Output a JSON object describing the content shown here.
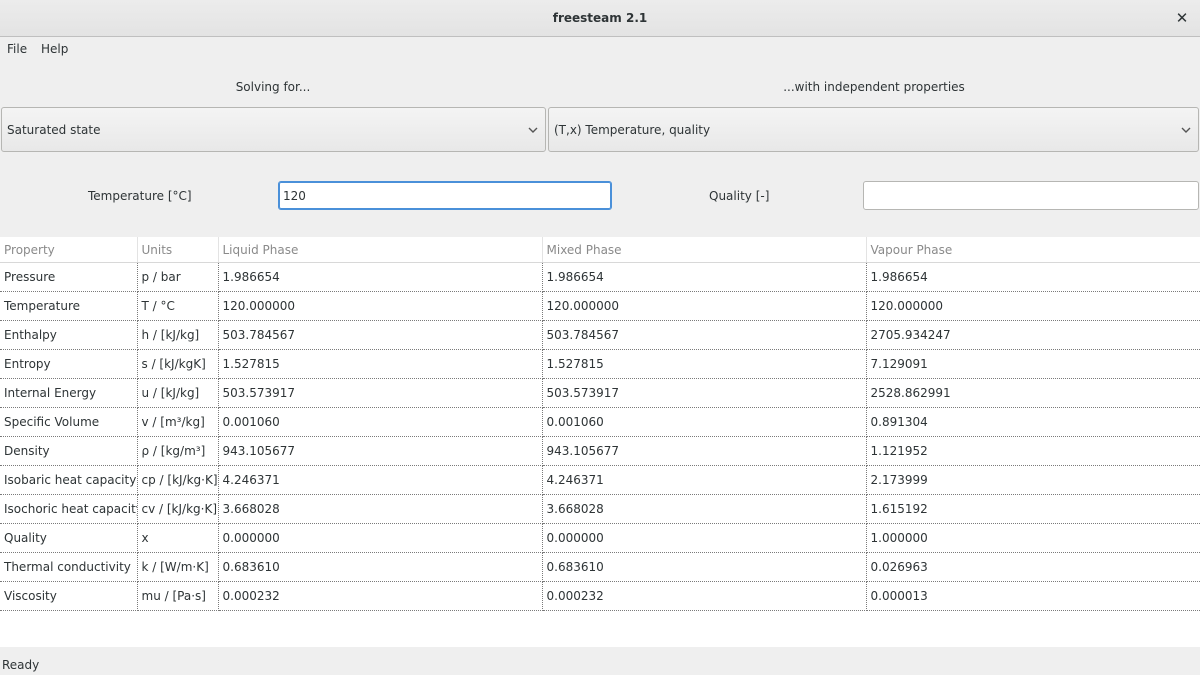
{
  "window": {
    "title": "freesteam 2.1"
  },
  "menu": {
    "file": "File",
    "help": "Help"
  },
  "solving_for": {
    "label": "Solving for...",
    "selected": "Saturated state"
  },
  "independent": {
    "label": "...with independent properties",
    "selected": "(T,x)  Temperature, quality"
  },
  "inputs": {
    "temperature_label": "Temperature [°C]",
    "temperature_value": "120",
    "quality_label": "Quality [-]",
    "quality_value": ""
  },
  "table": {
    "headers": [
      "Property",
      "Units",
      "Liquid Phase",
      "Mixed Phase",
      "Vapour Phase"
    ],
    "rows": [
      [
        "Pressure",
        "p / bar",
        "1.986654",
        "1.986654",
        "1.986654"
      ],
      [
        "Temperature",
        "T / °C",
        "120.000000",
        "120.000000",
        "120.000000"
      ],
      [
        "Enthalpy",
        "h / [kJ/kg]",
        "503.784567",
        "503.784567",
        "2705.934247"
      ],
      [
        "Entropy",
        "s / [kJ/kgK]",
        "1.527815",
        "1.527815",
        "7.129091"
      ],
      [
        "Internal Energy",
        "u / [kJ/kg]",
        "503.573917",
        "503.573917",
        "2528.862991"
      ],
      [
        "Specific Volume",
        "v / [m³/kg]",
        "0.001060",
        "0.001060",
        "0.891304"
      ],
      [
        "Density",
        "ρ / [kg/m³]",
        "943.105677",
        "943.105677",
        "1.121952"
      ],
      [
        "Isobaric heat capacity",
        "cp / [kJ/kg·K]",
        "4.246371",
        "4.246371",
        "2.173999"
      ],
      [
        "Isochoric heat capacity",
        "cv / [kJ/kg·K]",
        "3.668028",
        "3.668028",
        "1.615192"
      ],
      [
        "Quality",
        "x",
        "0.000000",
        "0.000000",
        "1.000000"
      ],
      [
        "Thermal conductivity",
        "k / [W/m·K]",
        "0.683610",
        "0.683610",
        "0.026963"
      ],
      [
        "Viscosity",
        "mu / [Pa·s]",
        "0.000232",
        "0.000232",
        "0.000013"
      ]
    ]
  },
  "status": "Ready"
}
